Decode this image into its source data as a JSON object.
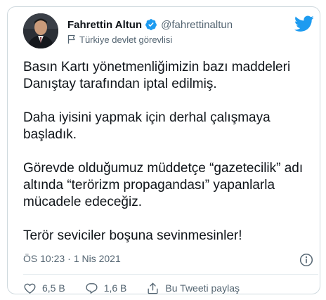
{
  "tweet": {
    "author_name": "Fahrettin Altun",
    "handle": "@fahrettinaltun",
    "account_label": "Türkiye devlet görevlisi",
    "paragraphs": [
      "Basın Kartı yönetmenliğimizin bazı maddeleri\nDanıştay tarafından iptal edilmiş.",
      "Daha iyisini yapmak için derhal çalışmaya\nbaşladık.",
      "Görevde olduğumuz müddetçe “gazetecilik” adı\naltında “terörizm propagandası” yapanlarla\nmücadele edeceğiz.",
      "Terör seviciler boşuna sevinmesinler!"
    ],
    "time": "ÖS 10:23",
    "separator": "·",
    "date": "1 Nis 2021"
  },
  "actions": {
    "likes": "6,5 B",
    "replies": "1,6 B",
    "share_label": "Bu Tweeti paylaş"
  },
  "icons": {
    "verified": "verified-badge-icon",
    "twitter": "twitter-bird-icon",
    "info": "info-icon",
    "like": "heart-icon",
    "reply": "reply-bubble-icon",
    "share": "share-icon",
    "label": "flag-icon"
  },
  "colors": {
    "brand_blue": "#1d9bf0",
    "text_primary": "#0f1419",
    "text_secondary": "#536471",
    "border": "#cfd9de"
  }
}
